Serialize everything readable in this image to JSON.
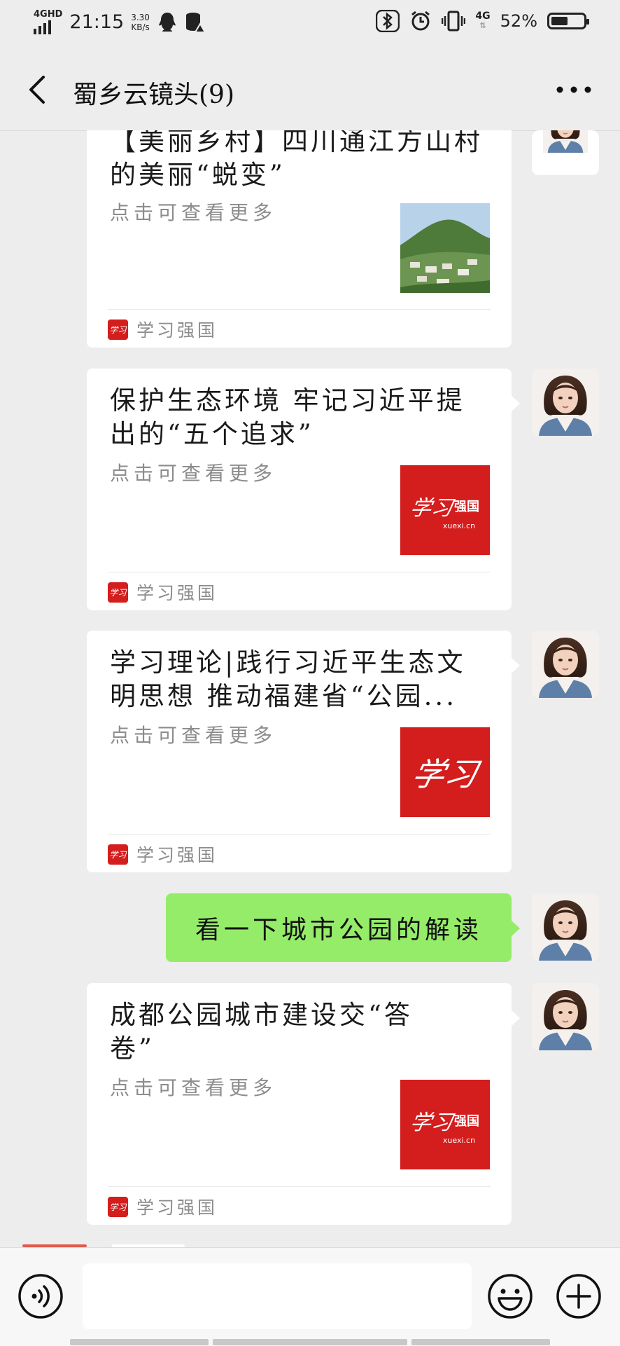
{
  "status_bar": {
    "network_label": "4GHD",
    "time": "21:15",
    "speed_value": "3.30",
    "speed_unit": "KB/s",
    "cell_label": "4G",
    "battery": "52%",
    "battery_level": 0.52
  },
  "header": {
    "title": "蜀乡云镜头(9)"
  },
  "messages": [
    {
      "type": "card",
      "title": "【美丽乡村】四川通江方山村的美丽“蜕变”",
      "desc": "点击可查看更多",
      "thumb": "village-landscape-photo",
      "source": "学习强国",
      "source_icon_text": "学习"
    },
    {
      "type": "card",
      "title": "保护生态环境 牢记习近平提出的“五个追求”",
      "desc": "点击可查看更多",
      "thumb": "xuexi-qiangguo-logo",
      "thumb_brand": "学习",
      "thumb_brand_side": "强国",
      "thumb_site": "xuexi.cn",
      "source": "学习强国",
      "source_icon_text": "学习"
    },
    {
      "type": "card",
      "title": "学习理论|践行习近平生态文明思想 推动福建省“公园...",
      "desc": "点击可查看更多",
      "thumb": "xuexi-logo",
      "thumb_brand": "学习",
      "source": "学习强国",
      "source_icon_text": "学习"
    },
    {
      "type": "text",
      "text": "看一下城市公园的解读"
    },
    {
      "type": "card",
      "title": "成都公园城市建设交“答卷”",
      "desc": "点击可查看更多",
      "thumb": "xuexi-qiangguo-logo",
      "thumb_brand": "学习",
      "thumb_brand_side": "强国",
      "thumb_site": "xuexi.cn",
      "source": "学习强国",
      "source_icon_text": "学习"
    }
  ],
  "input_bar": {
    "placeholder": ""
  },
  "colors": {
    "background": "#ededed",
    "bubble_green": "#95ec69",
    "xuexi_red": "#d41d1d"
  }
}
